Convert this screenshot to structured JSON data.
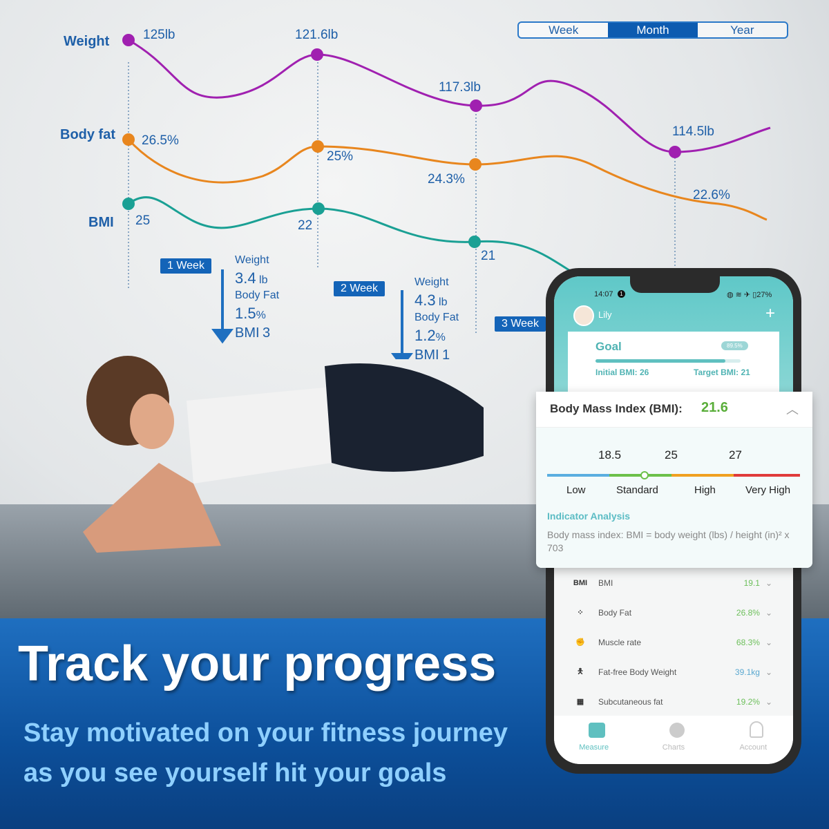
{
  "segment": {
    "options": [
      "Week",
      "Month",
      "Year"
    ],
    "selected": "Month"
  },
  "chart": {
    "labels": {
      "weight": "Weight",
      "bodyfat": "Body fat",
      "bmi": "BMI"
    },
    "weight": [
      "125lb",
      "121.6lb",
      "117.3lb",
      "114.5lb"
    ],
    "bodyfat": [
      "26.5%",
      "25%",
      "24.3%",
      "22.6%"
    ],
    "bmi": [
      "25",
      "22",
      "21"
    ],
    "colors": {
      "weight": "#a020b0",
      "bodyfat": "#e8861e",
      "bmi": "#1aa094"
    }
  },
  "weeks": [
    {
      "label": "1 Week",
      "weight_label": "Weight",
      "weight": "3.4",
      "weight_unit": "lb",
      "fat_label": "Body Fat",
      "fat": "1.5",
      "fat_unit": "%",
      "bmi_label": "BMI",
      "bmi": "3"
    },
    {
      "label": "2 Week",
      "weight_label": "Weight",
      "weight": "4.3",
      "weight_unit": "lb",
      "fat_label": "Body Fat",
      "fat": "1.2",
      "fat_unit": "%",
      "bmi_label": "BMI",
      "bmi": "1"
    },
    {
      "label": "3 Week"
    }
  ],
  "headline": "Track your progress",
  "subline1": "Stay motivated on your fitness journey",
  "subline2": "as you see yourself hit your goals",
  "phone": {
    "time": "14:07",
    "notif": "1",
    "battery": "27%",
    "user": "Lily",
    "goal": {
      "title": "Goal",
      "progress": "89.5%",
      "progress_value": 89.5,
      "initial": "Initial BMI: 26",
      "target": "Target BMI: 21"
    },
    "metrics": [
      {
        "icon": "BMI",
        "name": "BMI",
        "value": "19.1"
      },
      {
        "icon": "body-fat-icon",
        "name": "Body Fat",
        "value": "26.8%"
      },
      {
        "icon": "muscle-icon",
        "name": "Muscle rate",
        "value": "68.3%"
      },
      {
        "icon": "person-icon",
        "name": "Fat-free Body Weight",
        "value": "39.1kg"
      },
      {
        "icon": "subcutaneous-icon",
        "name": "Subcutaneous fat",
        "value": "19.2%"
      }
    ],
    "nav": [
      "Measure",
      "Charts",
      "Account"
    ]
  },
  "bmi_card": {
    "title": "Body Mass Index (BMI):",
    "value": "21.6",
    "thresholds": [
      "18.5",
      "25",
      "27"
    ],
    "ranges": [
      "Low",
      "Standard",
      "High",
      "Very High"
    ],
    "range_colors": [
      "#5aaee0",
      "#6cc04a",
      "#f0a020",
      "#e03a3a"
    ],
    "analysis_title": "Indicator Analysis",
    "analysis_text": "Body mass index: BMI = body weight (lbs) / height (in)² x 703"
  }
}
